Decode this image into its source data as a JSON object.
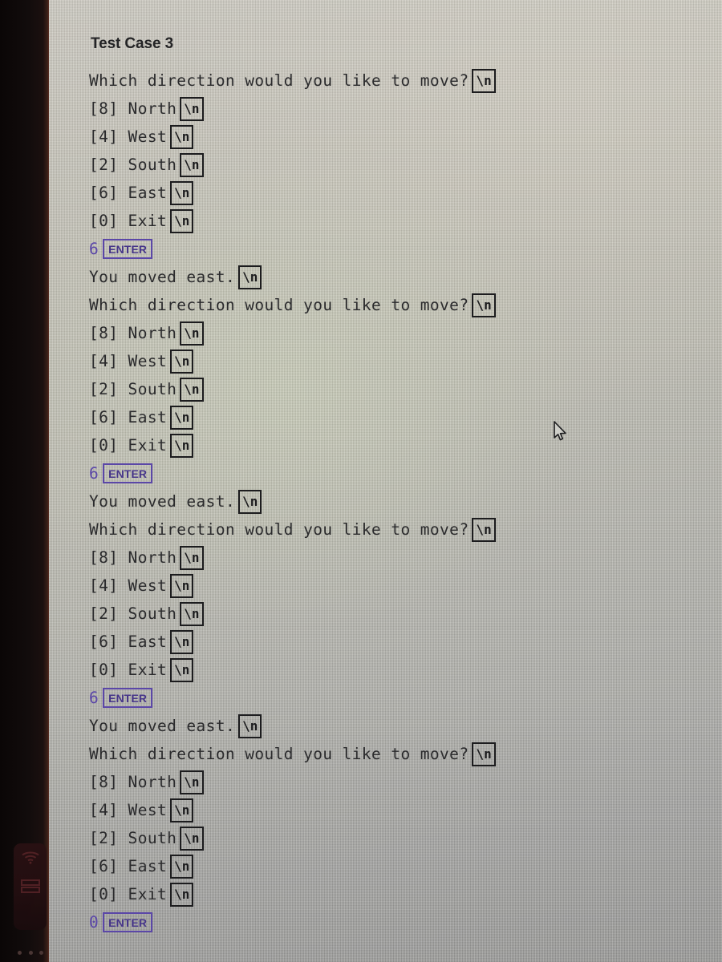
{
  "title": "Test Case 3",
  "prompt": "Which direction would you like to move?",
  "moved_message": "You moved east.",
  "newline_marker": "\\n",
  "enter_key_label": "ENTER",
  "menu": [
    {
      "key": "[8]",
      "label": "North",
      "text": "[8] North"
    },
    {
      "key": "[4]",
      "label": "West",
      "text": "[4] West"
    },
    {
      "key": "[2]",
      "label": "South",
      "text": "[2] South"
    },
    {
      "key": "[6]",
      "label": "East",
      "text": "[6] East"
    },
    {
      "key": "[0]",
      "label": "Exit",
      "text": "[0] Exit"
    }
  ],
  "inputs": {
    "first": "6",
    "second": "6",
    "third": "6",
    "fourth": "0"
  },
  "blocks": [
    {
      "prompt": "Which direction would you like to move?",
      "answer": "6",
      "result": "You moved east."
    },
    {
      "prompt": "Which direction would you like to move?",
      "answer": "6",
      "result": "You moved east."
    },
    {
      "prompt": "Which direction would you like to move?",
      "answer": "6",
      "result": "You moved east."
    },
    {
      "prompt": "Which direction would you like to move?",
      "answer": "0",
      "result": ""
    }
  ],
  "bezel": {
    "wifi_icon": "wifi-icon",
    "keyboard_icon": "keyboard-icon"
  },
  "colors": {
    "input_purple": "#5b47a8",
    "text_dark": "#2a2a2c",
    "screen_grey": "#bdbcb2",
    "bezel_black": "#120c0c"
  }
}
